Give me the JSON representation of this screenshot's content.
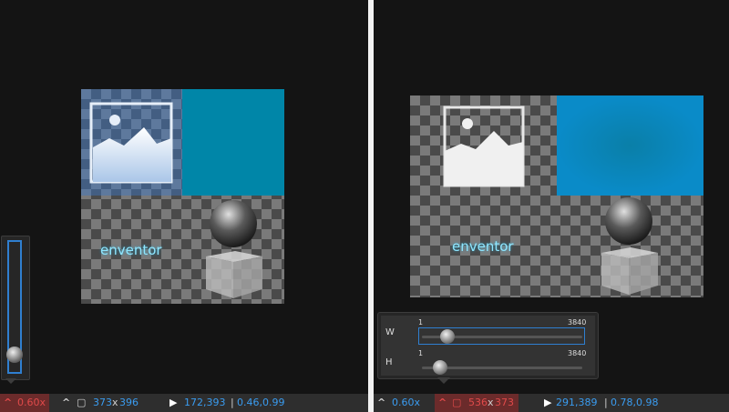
{
  "left": {
    "canvas_text": "enventor",
    "status": {
      "zoom": "0.60x",
      "size_w": "373",
      "size_x": "x",
      "size_h": "396",
      "cursor_pos": "172,393",
      "sep": "|",
      "rel_pos": "0.46,0.99"
    },
    "zoom_level": 0.6
  },
  "right": {
    "canvas_text": "enventor",
    "status": {
      "zoom": "0.60x",
      "size_w": "536",
      "size_x": "x",
      "size_h": "373",
      "cursor_pos": "291,389",
      "sep": "|",
      "rel_pos": "0.78,0.98"
    },
    "size_popup": {
      "w_label": "W",
      "h_label": "H",
      "w_min": "1",
      "w_max": "3840",
      "h_min": "1",
      "h_max": "3840"
    }
  },
  "colors": {
    "background": "#141414",
    "statusbar": "#2e2e2e",
    "accent_blue": "#3a9cf0",
    "teal": "#0086a8",
    "highlight_red": "#6b2b2b"
  }
}
